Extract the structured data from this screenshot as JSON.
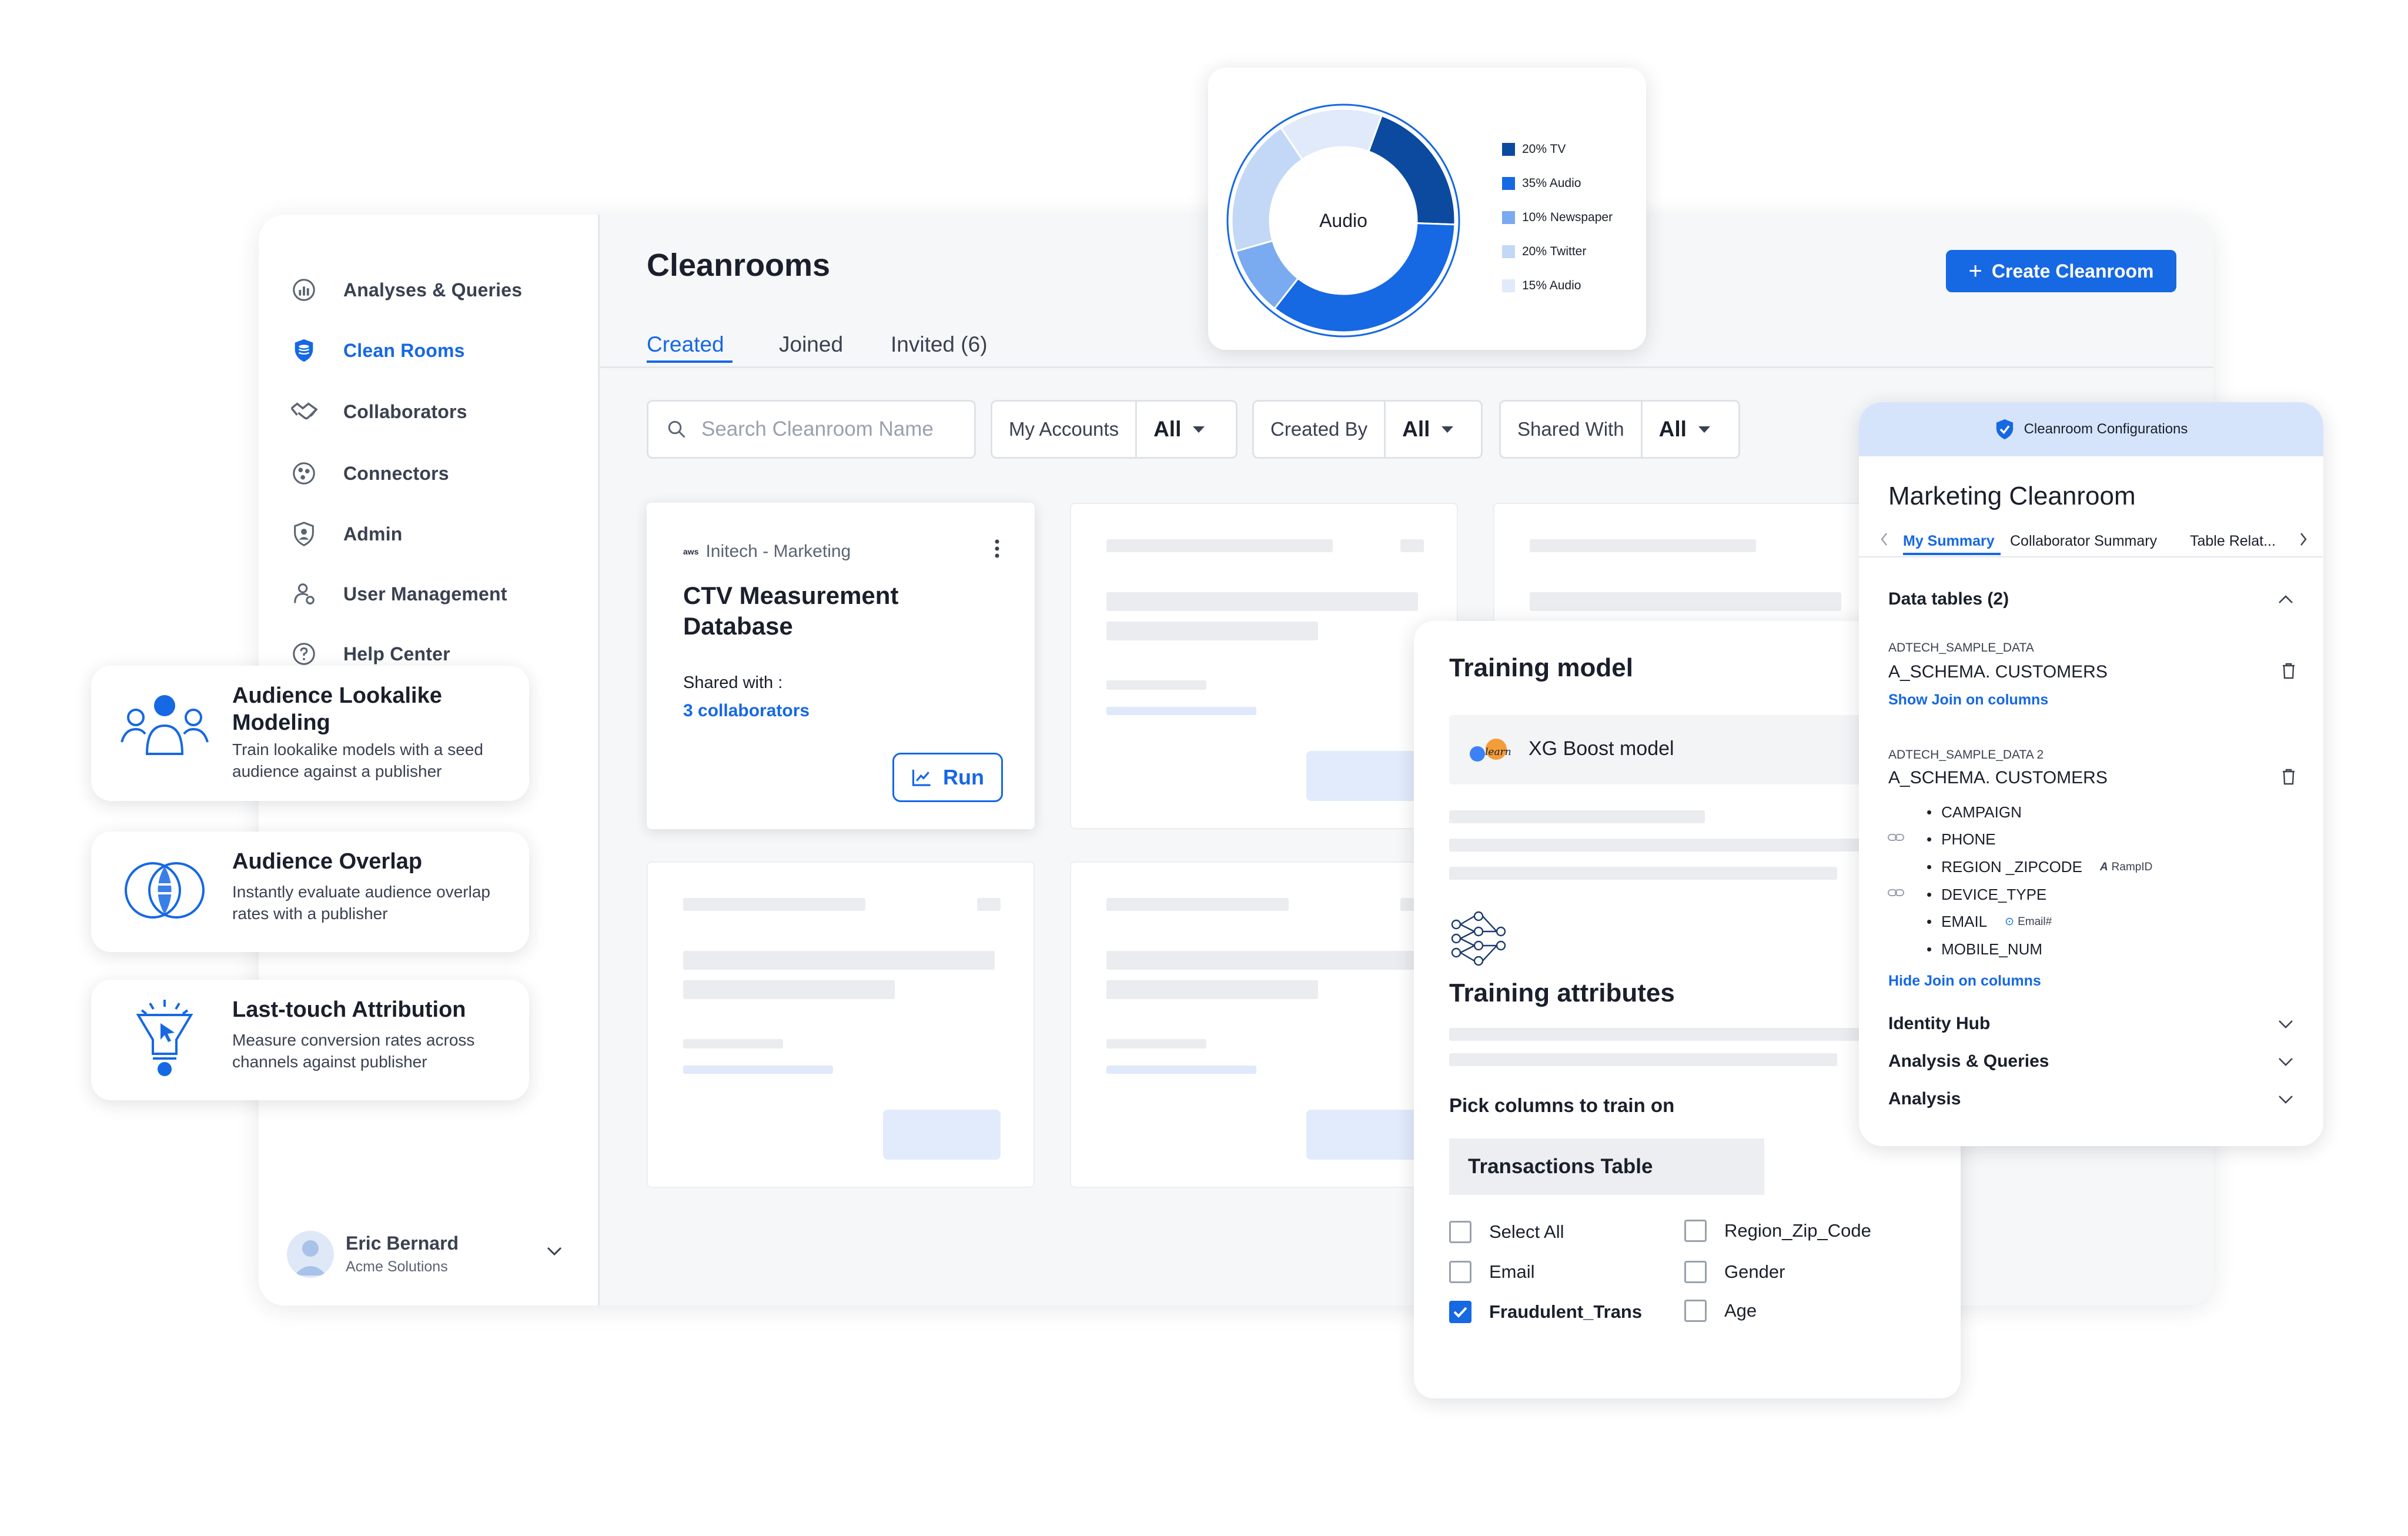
{
  "sidebar": {
    "items": [
      {
        "label": "Analyses & Queries",
        "icon": "analyses-icon",
        "active": false
      },
      {
        "label": "Clean Rooms",
        "icon": "shield-db-icon",
        "active": true
      },
      {
        "label": "Collaborators",
        "icon": "handshake-icon",
        "active": false
      },
      {
        "label": "Connectors",
        "icon": "connectors-icon",
        "active": false
      },
      {
        "label": "Admin",
        "icon": "admin-icon",
        "active": false
      },
      {
        "label": "User Management",
        "icon": "user-management-icon",
        "active": false
      },
      {
        "label": "Help Center",
        "icon": "help-icon",
        "active": false
      }
    ],
    "user": {
      "name": "Eric Bernard",
      "org": "Acme Solutions"
    }
  },
  "main": {
    "title": "Cleanrooms",
    "create_button": "Create Cleanroom",
    "tabs": [
      "Created",
      "Joined",
      "Invited (6)"
    ],
    "search_placeholder": "Search Cleanroom Name",
    "filters": [
      {
        "label": "My Accounts",
        "value": "All"
      },
      {
        "label": "Created By",
        "value": "All"
      },
      {
        "label": "Shared With",
        "value": "All"
      }
    ],
    "card": {
      "source": "Initech - Marketing",
      "title_line1": "CTV Measurement",
      "title_line2": "Database",
      "shared_label": "Shared with :",
      "collaborators": "3 collaborators",
      "run_label": "Run"
    }
  },
  "features": [
    {
      "title": "Audience Lookalike Modeling",
      "desc": "Train lookalike models with a seed audience against a publisher"
    },
    {
      "title": "Audience Overlap",
      "desc": "Instantly evaluate audience overlap rates with a publisher"
    },
    {
      "title": "Last-touch Attribution",
      "desc": "Measure conversion rates across channels against publisher"
    }
  ],
  "chart_data": {
    "type": "pie",
    "center_label": "Audio",
    "categories": [
      "TV",
      "Audio",
      "Newspaper",
      "Twitter",
      "Audio"
    ],
    "values": [
      20,
      35,
      10,
      20,
      15
    ],
    "legend": [
      "20% TV",
      "35% Audio",
      "10% Newspaper",
      "20% Twitter",
      "15% Audio"
    ],
    "colors": [
      "#0b4a9f",
      "#1668e3",
      "#7aaaf0",
      "#c3d7f7",
      "#e1eafa"
    ],
    "legend_position": "right"
  },
  "training": {
    "title": "Training model",
    "model": "XG Boost model",
    "attributes_title": "Training attributes",
    "pick_label": "Pick columns to train on",
    "table_label": "Transactions Table",
    "columns_left": [
      {
        "label": "Select All",
        "checked": false
      },
      {
        "label": "Email",
        "checked": false
      },
      {
        "label": "Fraudulent_Trans",
        "checked": true
      }
    ],
    "columns_right": [
      {
        "label": "Region_Zip_Code",
        "checked": false
      },
      {
        "label": "Gender",
        "checked": false
      },
      {
        "label": "Age",
        "checked": false
      }
    ]
  },
  "marketing": {
    "header": "Cleanroom Configurations",
    "title": "Marketing Cleanroom",
    "tabs": [
      "My Summary",
      "Collaborator Summary",
      "Table Relat..."
    ],
    "data_tables_label": "Data tables (2)",
    "table1": {
      "source": "ADTECH_SAMPLE_DATA",
      "name": "A_SCHEMA. CUSTOMERS",
      "link": "Show Join on columns"
    },
    "table2": {
      "source": "ADTECH_SAMPLE_DATA 2",
      "name": "A_SCHEMA. CUSTOMERS",
      "columns": [
        "CAMPAIGN",
        "PHONE",
        "REGION _ZIPCODE",
        "DEVICE_TYPE",
        "EMAIL",
        "MOBILE_NUM"
      ],
      "badge_region": "RampID",
      "badge_email": "Email#",
      "link": "Hide Join on columns"
    },
    "sections": [
      "Identity Hub",
      "Analysis & Queries",
      "Analysis"
    ]
  },
  "colors": {
    "accent": "#1668e3",
    "dark_blue": "#0b4a9f",
    "text": "#1a1f2b"
  }
}
